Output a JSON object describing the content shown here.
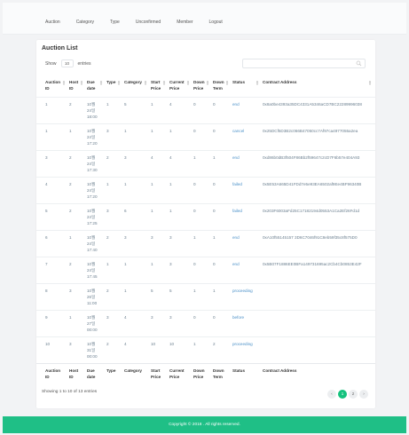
{
  "nav": {
    "items": [
      "Auction",
      "Category",
      "Type",
      "Unconfirmed",
      "Member",
      "Logout"
    ]
  },
  "card": {
    "title": "Auction List",
    "show_label": "Show",
    "page_length": "10",
    "entries_label": "entries"
  },
  "search": {
    "value": ""
  },
  "table": {
    "headers": [
      [
        "Auction",
        "ID"
      ],
      [
        "Host",
        "ID"
      ],
      [
        "Due",
        "date"
      ],
      [
        "Type"
      ],
      [
        "Category"
      ],
      [
        "Start",
        "Price"
      ],
      [
        "Current",
        "Price"
      ],
      [
        "Down",
        "Price"
      ],
      [
        "Down",
        "Term"
      ],
      [
        "Status"
      ],
      [
        "Contract Address"
      ]
    ],
    "rows": [
      [
        "1",
        "2",
        "10월 24일 18:00",
        "1",
        "5",
        "1",
        "4",
        "0",
        "0",
        "end",
        "0x8a0be4393a35DC4331A5346aCD7BC22289996038"
      ],
      [
        "1",
        "1",
        "10월 24일 17:20",
        "3",
        "1",
        "1",
        "1",
        "0",
        "0",
        "cancel",
        "0x25DCf5D3B2c066B47050cc7Af97ca4977055a2ea"
      ],
      [
        "3",
        "2",
        "10월 24일 17:30",
        "2",
        "3",
        "4",
        "4",
        "1",
        "1",
        "end",
        "0xd86b0dB3f504F86Bb2f59647c2cD7F6b57e404A93"
      ],
      [
        "4",
        "2",
        "10월 24일 17:20",
        "1",
        "1",
        "1",
        "1",
        "0",
        "0",
        "failed",
        "0x5E53A665D41FDd7e5e93EA6502af9Ee4BF96340B"
      ],
      [
        "5",
        "2",
        "10월 24일 17:25",
        "3",
        "6",
        "1",
        "1",
        "0",
        "0",
        "failed",
        "0x203F6003aFd25C17182194d0553A1Ca2Ef26Fd1d"
      ],
      [
        "6",
        "1",
        "10월 24일 17:40",
        "2",
        "3",
        "3",
        "3",
        "1",
        "1",
        "end",
        "0xA10f55145157 3D6C7046f91C8eb59f35c8f575D0"
      ],
      [
        "7",
        "2",
        "10월 24일 17:45",
        "1",
        "1",
        "1",
        "3",
        "0",
        "0",
        "end",
        "0x5B07F1886EE0BFa149731695ac2Cb4Cb0853E42F"
      ],
      [
        "8",
        "3",
        "10월 26일 11:00",
        "2",
        "1",
        "5",
        "5",
        "1",
        "1",
        "proceeding",
        ""
      ],
      [
        "9",
        "1",
        "10월 27일 00:00",
        "3",
        "4",
        "3",
        "3",
        "0",
        "0",
        "before",
        ""
      ],
      [
        "10",
        "3",
        "10월 31일 00:00",
        "2",
        "4",
        "10",
        "10",
        "1",
        "2",
        "proceeding",
        ""
      ]
    ]
  },
  "pagination": {
    "info": "Showing 1 to 10 of 13 entries",
    "prev": "‹",
    "pages": [
      "1",
      "2"
    ],
    "next": "›"
  },
  "footer": {
    "text": "Copyright © 2018 . All rights reserved."
  },
  "colors": {
    "accent": "#1fbf86",
    "link": "#4a90c8",
    "page_bg": "#f2f3f5"
  }
}
